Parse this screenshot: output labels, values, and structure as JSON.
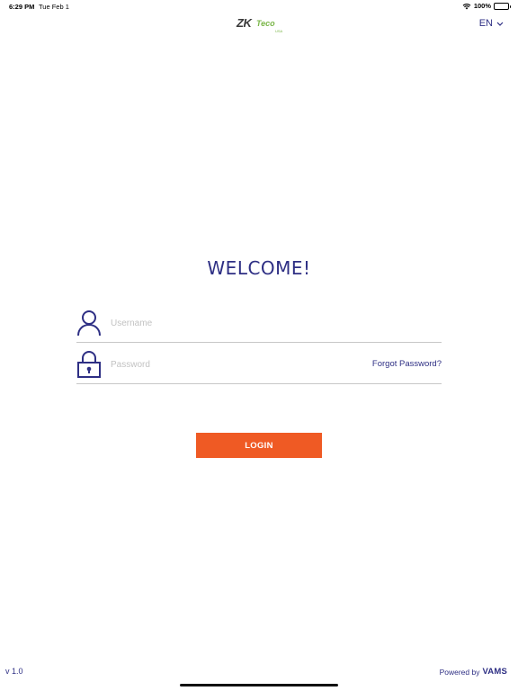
{
  "status_bar": {
    "time": "6:29 PM",
    "date": "Tue Feb 1",
    "battery": "100%"
  },
  "header": {
    "logo_main": "ZK",
    "logo_accent": "Teco",
    "logo_sub": "USA",
    "language": "EN"
  },
  "welcome": {
    "title": "WELCOME!"
  },
  "form": {
    "username_placeholder": "Username",
    "password_placeholder": "Password",
    "forgot_label": "Forgot Password?",
    "login_label": "LOGIN"
  },
  "footer": {
    "version": "v 1.0",
    "powered_by": "Powered by",
    "brand": "VAMS"
  },
  "colors": {
    "primary": "#2e2f84",
    "accent": "#ef5a24",
    "logo_green": "#7ab648"
  },
  "icons": {
    "wifi": "wifi-icon",
    "battery": "battery-icon",
    "language_chevron": "chevron-down-icon",
    "username": "user-icon",
    "password": "lock-icon"
  }
}
